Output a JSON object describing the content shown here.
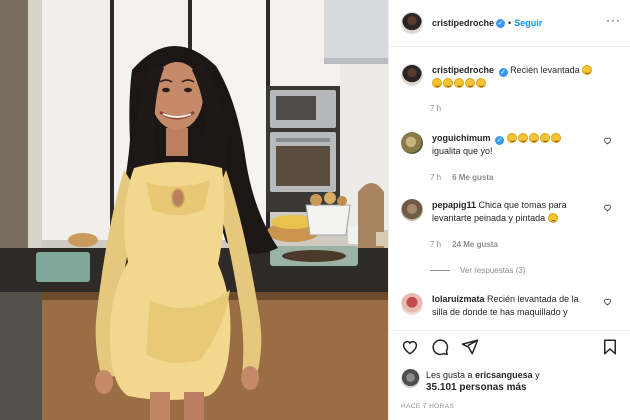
{
  "header": {
    "username": "cristipedroche",
    "separator": "•",
    "follow_label": "Seguir",
    "more_label": "···"
  },
  "caption": {
    "username": "cristipedroche",
    "text": "Recién levantada",
    "time": "7 h"
  },
  "comments": [
    {
      "username": "yoguichimum",
      "text": "igualita que yo!",
      "time": "7 h",
      "likes": "6 Me gusta"
    },
    {
      "username": "pepapig11",
      "text": "Chica que tomas para levantarte peinada y pintada",
      "time": "7 h",
      "likes": "24 Me gusta",
      "view_replies": "Ver respuestas (3)"
    },
    {
      "username": "lolaruizmata",
      "text": "Recién levantada de la silla de donde te has maquillado y"
    }
  ],
  "likes": {
    "prefix": "Les gusta a",
    "user": "ericsanguesa",
    "conj": "y",
    "count": "35.101 personas más"
  },
  "posted_ago": "HACE 7 HORAS",
  "icons": {
    "like": "heart-icon",
    "comment": "comment-icon",
    "share": "paper-plane-icon",
    "save": "bookmark-icon"
  },
  "colors": {
    "accent": "#0095f6",
    "verified": "#3897f0",
    "muted": "#8e8e8e",
    "dress": "#f2d78e"
  }
}
